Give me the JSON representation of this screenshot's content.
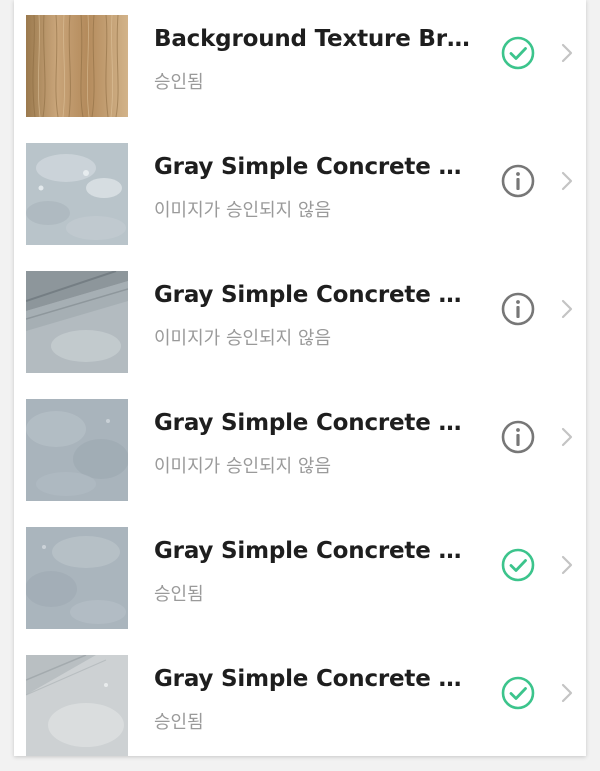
{
  "items": [
    {
      "title": "Background Texture Bri...",
      "status": "승인됨",
      "state": "approved",
      "thumbnail": "wood-texture",
      "status_icon": "check-circle-icon"
    },
    {
      "title": "Gray Simple Concrete St...",
      "status": "이미지가 승인되지 않음",
      "state": "not-approved",
      "thumbnail": "concrete-texture-light",
      "status_icon": "info-circle-icon"
    },
    {
      "title": "Gray Simple Concrete St...",
      "status": "이미지가 승인되지 않음",
      "state": "not-approved",
      "thumbnail": "concrete-texture-shadow",
      "status_icon": "info-circle-icon"
    },
    {
      "title": "Gray Simple Concrete St...",
      "status": "이미지가 승인되지 않음",
      "state": "not-approved",
      "thumbnail": "concrete-texture-blue",
      "status_icon": "info-circle-icon"
    },
    {
      "title": "Gray Simple Concrete St...",
      "status": "승인됨",
      "state": "approved",
      "thumbnail": "concrete-texture-blue",
      "status_icon": "check-circle-icon"
    },
    {
      "title": "Gray Simple Concrete St...",
      "status": "승인됨",
      "state": "approved",
      "thumbnail": "concrete-texture-pale",
      "status_icon": "check-circle-icon"
    }
  ],
  "colors": {
    "approved": "#3cc48c",
    "not_approved": "#777777",
    "chevron": "#c4c4c4",
    "title": "#1e1e1e",
    "status_text": "#9a9a9a"
  }
}
